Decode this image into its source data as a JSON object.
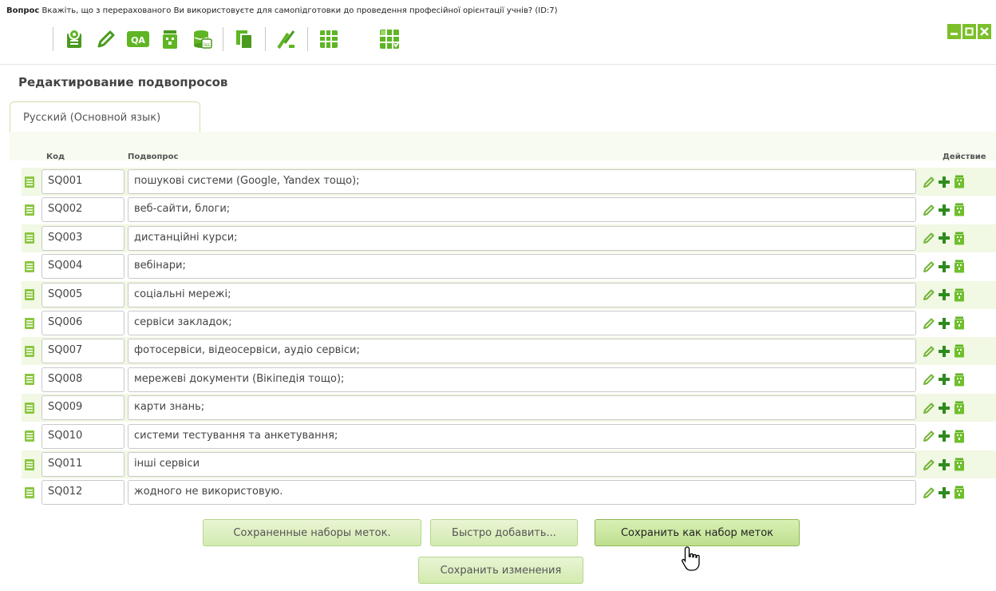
{
  "question": {
    "prefix": "Вопрос",
    "text": "Вкажіть, що з перерахованого Ви використовуєте для самопідготовки до проведення професійної орієнтації учнів? (ID:7)"
  },
  "toolbar": {
    "icons": [
      "question-settings-icon",
      "edit-pencil-icon",
      "qa-icon",
      "delete-question-icon",
      "export-db-icon",
      "copy-icon",
      "conditions-icon",
      "answers-grid-icon",
      "subquestions-grid-icon"
    ]
  },
  "window_controls": [
    "minimize-icon",
    "maximize-icon",
    "close-icon"
  ],
  "section_title": "Редактирование подвопросов",
  "tab_label": "Русский (Основной язык)",
  "columns": {
    "code": "Код",
    "subquestion": "Подвопрос",
    "action": "Действие"
  },
  "rows": [
    {
      "code": "SQ001",
      "text": "пошукові системи (Google, Yandex тощо);"
    },
    {
      "code": "SQ002",
      "text": "веб-сайти, блоги;"
    },
    {
      "code": "SQ003",
      "text": "дистанційні курси;"
    },
    {
      "code": "SQ004",
      "text": "вебінари;"
    },
    {
      "code": "SQ005",
      "text": "соціальні мережі;"
    },
    {
      "code": "SQ006",
      "text": "сервіси закладок;"
    },
    {
      "code": "SQ007",
      "text": "фотосервіси, відеосервіси, аудіо сервіси;"
    },
    {
      "code": "SQ008",
      "text": "мережеві документи (Вікіпедія тощо);"
    },
    {
      "code": "SQ009",
      "text": "карти знань;"
    },
    {
      "code": "SQ010",
      "text": "системи тестування та анкетування;"
    },
    {
      "code": "SQ011",
      "text": "інші сервіси"
    },
    {
      "code": "SQ012",
      "text": "жодного не використовую."
    }
  ],
  "buttons": {
    "saved_label_sets": "Сохраненные наборы меток.",
    "quick_add": "Быстро добавить...",
    "save_as_label_set": "Сохранить как набор меток",
    "save_changes": "Сохранить изменения"
  },
  "colors": {
    "accent_green": "#7bbf2a",
    "icon_dark_green": "#2f8a2f",
    "row_alt": "#f1f8e4",
    "button_bg": "#d3eab0"
  }
}
